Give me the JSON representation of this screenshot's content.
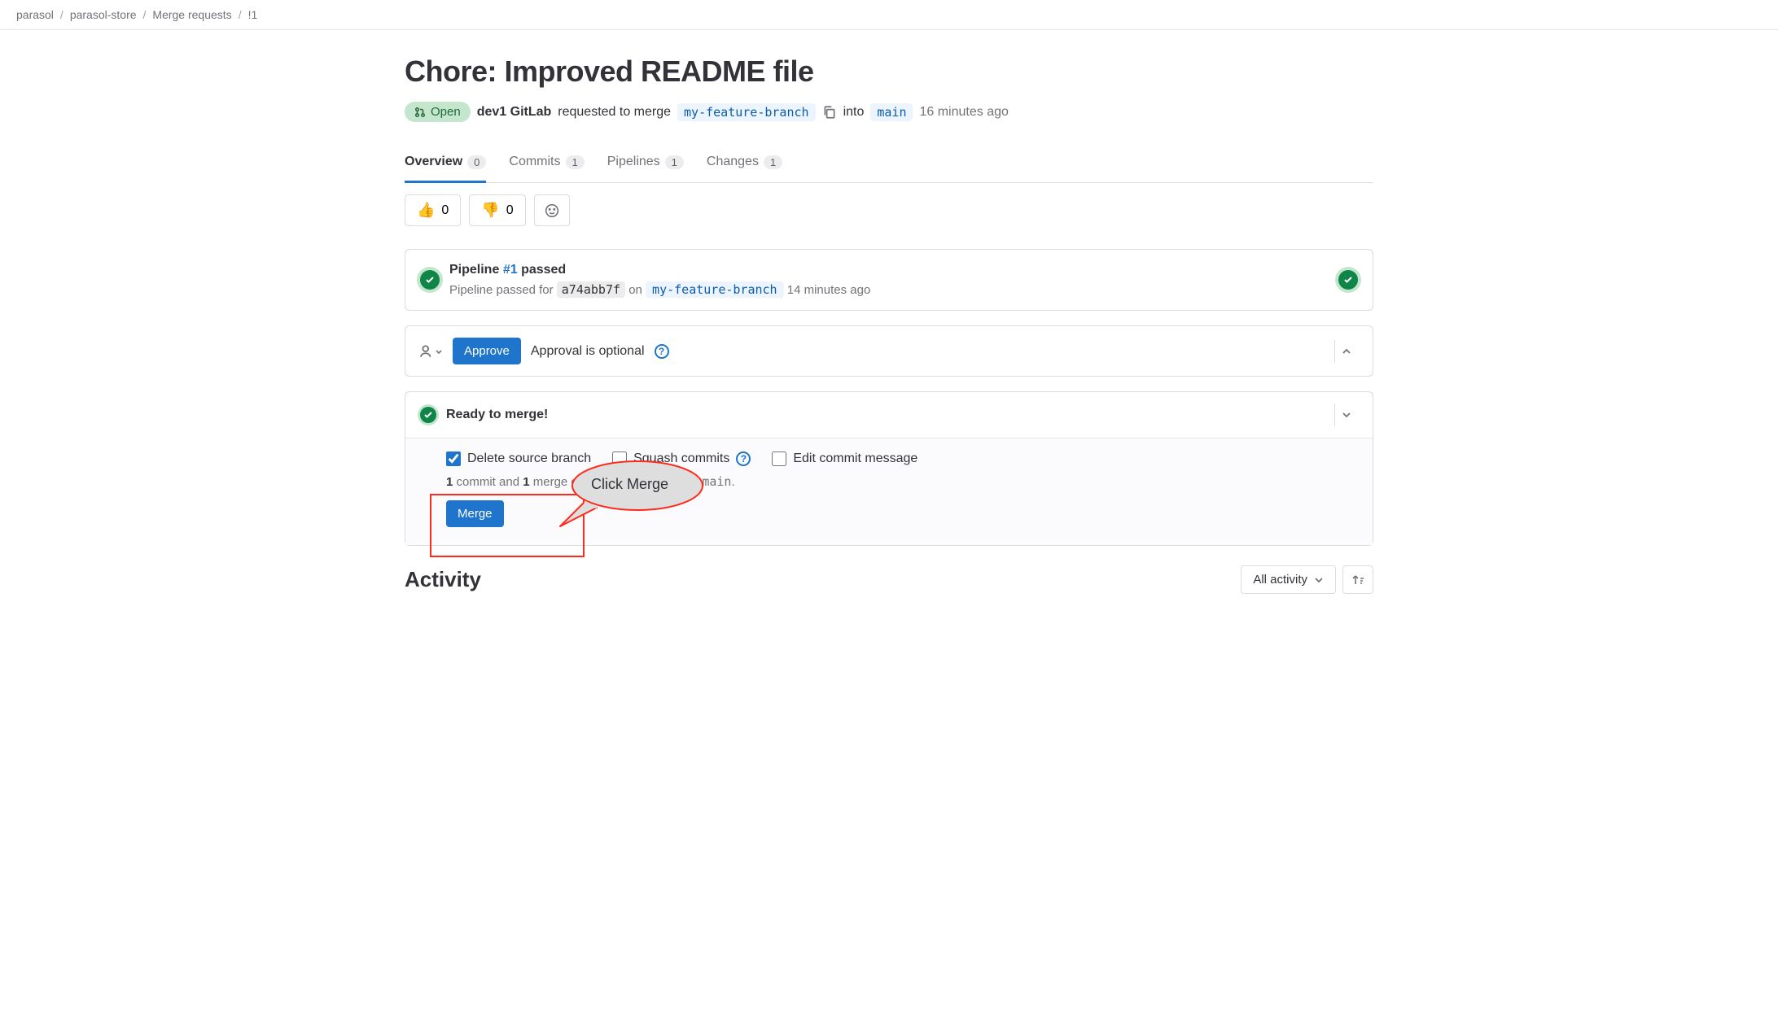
{
  "breadcrumb": [
    {
      "label": "parasol"
    },
    {
      "label": "parasol-store"
    },
    {
      "label": "Merge requests"
    },
    {
      "label": "!1"
    }
  ],
  "mr": {
    "title": "Chore: Improved README file",
    "status": "Open",
    "author": "dev1 GitLab",
    "action_text": "requested to merge",
    "source_branch": "my-feature-branch",
    "into_text": "into",
    "target_branch": "main",
    "time_ago": "16 minutes ago"
  },
  "tabs": [
    {
      "label": "Overview",
      "count": "0",
      "active": true
    },
    {
      "label": "Commits",
      "count": "1",
      "active": false
    },
    {
      "label": "Pipelines",
      "count": "1",
      "active": false
    },
    {
      "label": "Changes",
      "count": "1",
      "active": false
    }
  ],
  "reactions": {
    "thumbs_up": "0",
    "thumbs_down": "0"
  },
  "pipeline": {
    "prefix": "Pipeline",
    "link": "#1",
    "status": "passed",
    "sub_prefix": "Pipeline passed for",
    "commit": "a74abb7f",
    "on": "on",
    "branch": "my-feature-branch",
    "time_ago": "14 minutes ago"
  },
  "approval": {
    "button": "Approve",
    "text": "Approval is optional"
  },
  "merge": {
    "ready": "Ready to merge!",
    "delete_label": "Delete source branch",
    "delete_checked": true,
    "squash_label": "Squash commits",
    "squash_checked": false,
    "edit_label": "Edit commit message",
    "edit_checked": false,
    "summary_commits": "1",
    "summary_text1": " commit and ",
    "summary_merges": "1",
    "summary_text2": " merge commit will be added to ",
    "summary_branch": "main",
    "button": "Merge"
  },
  "callout": {
    "text": "Click Merge"
  },
  "activity": {
    "title": "Activity",
    "filter": "All activity"
  }
}
